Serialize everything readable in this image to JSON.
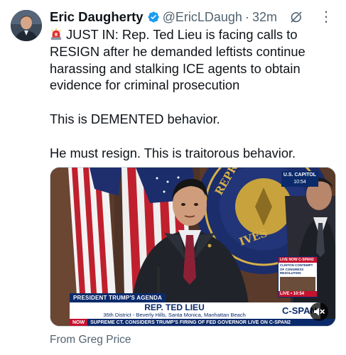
{
  "tweet": {
    "author_name": "Eric Daugherty",
    "handle": "@EricLDaugh",
    "separator": "·",
    "time": "32m",
    "verified": true,
    "body": "JUST IN: Rep. Ted Lieu is facing calls to RESIGN after he demanded leftists continue harassing and stalking ICE agents to obtain evidence for criminal prosecution\n\nThis is DEMENTED behavior.\n\nHe must resign. This is traitorous behavior.",
    "from_line": "From Greg Price",
    "icons": {
      "avatar": "avatar-photo",
      "verified": "verified-badge-icon",
      "grok": "grok-icon",
      "more": "more-icon",
      "siren": "siren-emoji-icon",
      "mute": "mute-icon"
    }
  },
  "video": {
    "chyron_tag": "PRESIDENT TRUMP'S AGENDA",
    "chyron_name": "REP. TED LIEU",
    "chyron_sub": "36th District - Beverly Hills, Santa Monica, Manhattan Beach",
    "logo": "C-SPAN",
    "ticker_badge": "NOW",
    "ticker_text": "SUPREME CT. CONSIDERS TRUMP'S FIRING OF FED GOVERNOR   LIVE ON C-SPAN2",
    "capitol_badge": "U.S. CAPITOL",
    "capitol_time": "10:54",
    "live_box_top": "LIVE NOW C-SPAN2",
    "live_box_desc": "CLINTON CONTEMPT OF CONGRESS RESOLUTION",
    "live_box_bottom": "LIVE • 10:54",
    "seal_text": "HOUSE OF REPRESENTATIVES"
  },
  "colors": {
    "text_primary": "#0f1419",
    "text_secondary": "#536471",
    "verified_blue": "#1d9bf0",
    "cspan_navy": "#0b2a6b",
    "cspan_red": "#c4122f"
  }
}
